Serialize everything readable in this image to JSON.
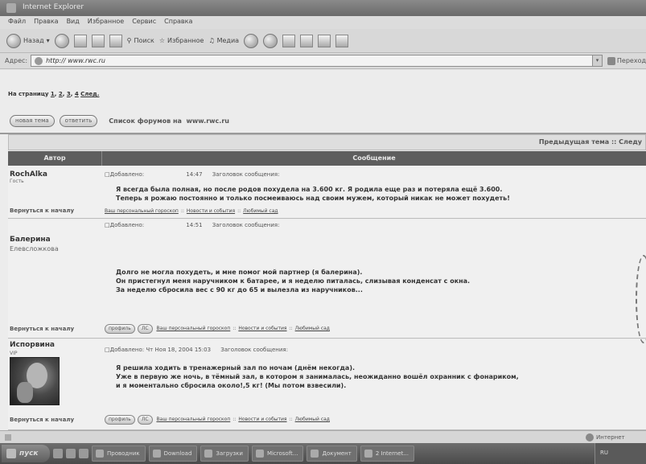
{
  "window": {
    "title": "Internet Explorer"
  },
  "menu": [
    "Файл",
    "Правка",
    "Вид",
    "Избранное",
    "Сервис",
    "Справка"
  ],
  "toolbar": {
    "back": "Назад",
    "search": "Поиск",
    "favorites": "Избранное",
    "media": "Медиа"
  },
  "address": {
    "label": "Адрес:",
    "url": "http:// www.rwc.ru",
    "go": "Переход"
  },
  "forum": {
    "pages_label": "На страницу",
    "pages": [
      "1",
      "2",
      "3",
      "4"
    ],
    "next": "След.",
    "new_topic": "новая тема",
    "reply": "ответить",
    "forum_list": "Список форумов на",
    "site": "www.rwc.ru",
    "nav": "Предыдущая тема :: Следу",
    "col_author": "Автор",
    "col_message": "Сообщение",
    "added_label": "Добавлено:",
    "subject_label": "Заголовок сообщения:",
    "back_to_top": "Вернуться к началу",
    "profile_btn": "профиль",
    "pm_btn": "ЛС",
    "sig_parts": [
      "Ваш персональный гороскоп",
      "Новости и события",
      "Любимый сад"
    ]
  },
  "posts": [
    {
      "author": "RochAlka",
      "rank": "Гость",
      "time": "14:47",
      "date": "",
      "lines": [
        "Я всегда была полная, но после родов похудела на 3.600 кг. Я родила еще раз и потеряла ещё 3.600.",
        "Теперь я рожаю постоянно и только посмеиваюсь над своим мужем, который никак не может похудеть!"
      ]
    },
    {
      "author": "Балерина",
      "author_line2": "Елевсложкова",
      "rank": "",
      "time": "14:51",
      "date": "",
      "lines": [
        "Долго не могла похудеть, и мне помог мой партнер (я балерина).",
        "Он пристегнул меня наручником к батарее, и я неделю питалась, слизывая конденсат с окна.",
        "За неделю сбросила вес с 90 кг до 65 и вылезла из наручников..."
      ]
    },
    {
      "author": "Испорвина",
      "rank": "VIP",
      "time": "15:03",
      "date": "Чт Ноя 18, 2004",
      "lines": [
        "Я решила ходить в тренажерный зал по ночам (днём некогда).",
        "Уже в первую же ночь, в тёмный зал, в котором я занималась, неожиданно вошёл охранник с фонариком,",
        "и я моментально сбросила около!,5 кг! (Мы потом взвесили)."
      ]
    }
  ],
  "status": {
    "zone": "Интернет"
  },
  "taskbar": {
    "start": "пуск",
    "tasks": [
      "Проводник",
      "Download",
      "Загрузки",
      "Microsoft...",
      "Документ",
      "2 Internet..."
    ],
    "clock": "RU"
  }
}
